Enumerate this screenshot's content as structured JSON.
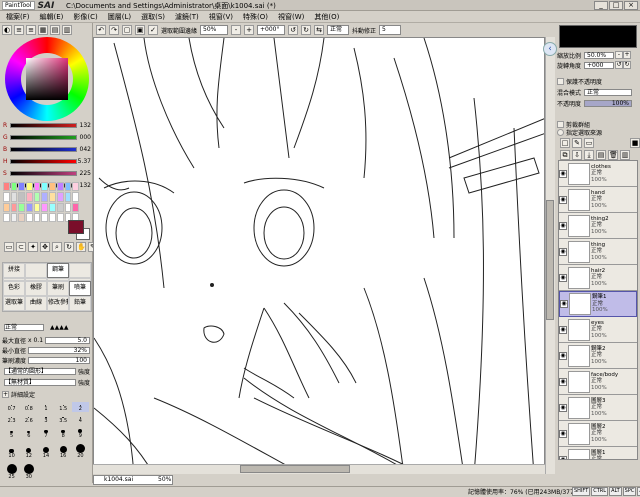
{
  "title": {
    "logo_badge": "PaintTool",
    "logo_name": "SAI",
    "path": "C:\\Documents and Settings\\Administrator\\桌面\\k1004.sai (*)"
  },
  "menu": [
    "檔案(F)",
    "編輯(E)",
    "影像(C)",
    "圖層(L)",
    "選取(S)",
    "濾鏡(T)",
    "視窗(V)",
    "特殊(O)",
    "視窗(W)",
    "其他(O)"
  ],
  "toolbar": {
    "select_label": "選取範圍邊緣",
    "zoom": "50%",
    "rotation": "+000°",
    "mode": "正常",
    "stabilizer_label": "抖動修正",
    "stabilizer": "5"
  },
  "color": {
    "sliders": [
      {
        "label": "R",
        "value": "132",
        "color": "#d02020"
      },
      {
        "label": "G",
        "value": "000",
        "color": "#20a020"
      },
      {
        "label": "B",
        "value": "042",
        "color": "#2030d0"
      },
      {
        "label": "H",
        "value": "5.37",
        "color": "#ff0000"
      },
      {
        "label": "S",
        "value": "225",
        "color": "#c04080"
      },
      {
        "label": "V",
        "value": "132",
        "color": "#404040"
      }
    ],
    "current": "#7a0e2a",
    "swatches": [
      "#ff8080",
      "#80ff80",
      "#8080ff",
      "#ffff80",
      "#ff80ff",
      "#80ffff",
      "#ffc080",
      "#c080ff",
      "#80c0ff",
      "#ffd0e0",
      "#ffffff",
      "#e0e0e0",
      "#c0c0c0",
      "#ffb0c0",
      "#b0ffb0",
      "#b0b0ff",
      "#ffe0a0",
      "#e0a0ff",
      "#a0e0ff",
      "#ffffff",
      "#ffcc99",
      "#ff9999",
      "#99ff99",
      "#9999ff",
      "#ffff99",
      "#ff99ff",
      "#99ffff",
      "#cccccc",
      "#ffffff",
      "#ff66aa",
      "#ffffff",
      "#f0f0f0",
      "#e8d0c0",
      "#ffffff",
      "#ffffff",
      "#ffffff",
      "#ffffff",
      "#ffffff",
      "#ffffff",
      "#ffffff"
    ]
  },
  "tools": [
    "拼接",
    "",
    "鋼筆",
    "",
    " ",
    "",
    "",
    "",
    "色彩",
    "橡膠",
    "筆刷",
    "噴筆",
    "選取筆",
    "曲線",
    "修改參數",
    "鉛筆"
  ],
  "brush": {
    "mode": "正常",
    "max_size_label": "最大直徑",
    "max_size_mult": "x 0.1",
    "max_size_value": "5.0",
    "min_size_label": "最小直徑",
    "min_size_value": "32%",
    "density_label": "筆刷濃度",
    "density_value": "100",
    "shape_label": "【通常的圓形】",
    "shape_value": "強度",
    "texture_label": "【無材質】",
    "texture_value": "強度",
    "detail_label": "詳細設定",
    "sizes": [
      "0.7",
      "0.8",
      "1",
      "1.5",
      "2",
      "2.3",
      "2.6",
      "3",
      "3.5",
      "4",
      "5",
      "6",
      "7",
      "8",
      "9",
      "10",
      "12",
      "14",
      "16",
      "20",
      "25",
      "30"
    ]
  },
  "document": {
    "tab": "k1004.sai",
    "zoom": "50%"
  },
  "right": {
    "zoom_label": "縮放比例",
    "zoom_value": "50.0%",
    "angle_label": "旋轉角度",
    "angle_value": "+000",
    "preserve_opacity": "保護不透明度",
    "blend_label": "混合模式",
    "blend_value": "正常",
    "opacity_label": "不透明度",
    "opacity_value": "100%",
    "clip_label": "剪裁群組",
    "ref_label": "指定選取來源",
    "layers": [
      {
        "name": "clothes",
        "mode": "正常",
        "pct": "100%"
      },
      {
        "name": "hand",
        "mode": "正常",
        "pct": "100%"
      },
      {
        "name": "thing2",
        "mode": "正常",
        "pct": "100%"
      },
      {
        "name": "thing",
        "mode": "正常",
        "pct": "100%"
      },
      {
        "name": "hair2",
        "mode": "正常",
        "pct": "100%"
      },
      {
        "name": "鋼筆1",
        "mode": "正常",
        "pct": "100%",
        "selected": true
      },
      {
        "name": "eyes",
        "mode": "正常",
        "pct": "100%"
      },
      {
        "name": "鋼筆2",
        "mode": "正常",
        "pct": "100%"
      },
      {
        "name": "face/body",
        "mode": "正常",
        "pct": "100%"
      },
      {
        "name": "圖層3",
        "mode": "正常",
        "pct": "100%"
      },
      {
        "name": "圖層2",
        "mode": "正常",
        "pct": "100%"
      },
      {
        "name": "圖層1",
        "mode": "正常",
        "pct": "100%"
      }
    ]
  },
  "status": {
    "memory": "記憶體使用率：76% (已用243MB/377MB)",
    "indicators": [
      "SHIFT",
      "CTRL",
      "ALT",
      "SPC",
      "ANY"
    ]
  }
}
